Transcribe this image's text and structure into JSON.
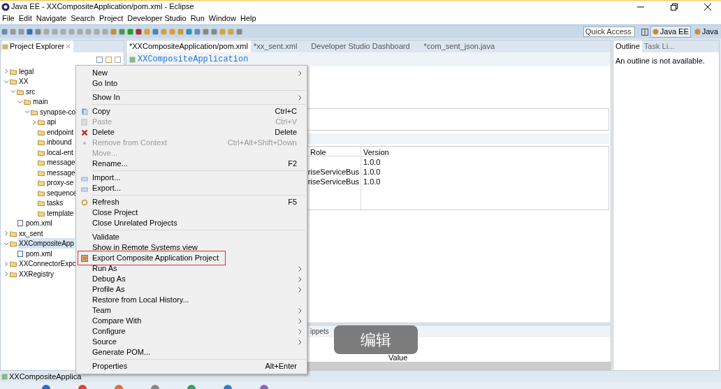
{
  "window": {
    "title": "Java EE - XXCompositeApplication/pom.xml - Eclipse"
  },
  "menubar": [
    "File",
    "Edit",
    "Navigate",
    "Search",
    "Project",
    "Developer Studio",
    "Run",
    "Window",
    "Help"
  ],
  "toolbar": {
    "quick_access": {
      "placeholder": "Quick Access"
    },
    "perspectives": [
      {
        "label": "Java EE",
        "selected": true
      },
      {
        "label": "Java",
        "selected": false
      }
    ]
  },
  "project_explorer": {
    "title": "Project Explorer",
    "tree": [
      {
        "label": "legal",
        "expanded": false,
        "selected": false
      },
      {
        "label": "XX",
        "expanded": true,
        "selected": false,
        "children": [
          {
            "label": "src",
            "expanded": true,
            "selected": false,
            "children": [
              {
                "label": "main",
                "expanded": true,
                "selected": false,
                "children": [
                  {
                    "label": "synapse-co",
                    "expanded": true,
                    "selected": false,
                    "children": [
                      {
                        "label": "api",
                        "expanded": false,
                        "selected": false
                      },
                      {
                        "label": "endpoint",
                        "selected": false
                      },
                      {
                        "label": "inbound",
                        "selected": false
                      },
                      {
                        "label": "local-ent",
                        "selected": false
                      },
                      {
                        "label": "message",
                        "selected": false
                      },
                      {
                        "label": "message",
                        "selected": false
                      },
                      {
                        "label": "proxy-se",
                        "selected": false
                      },
                      {
                        "label": "sequence",
                        "selected": false
                      },
                      {
                        "label": "tasks",
                        "selected": false
                      },
                      {
                        "label": "template",
                        "selected": false
                      }
                    ]
                  }
                ]
              }
            ]
          },
          {
            "label": "pom.xml",
            "selected": false
          }
        ]
      },
      {
        "label": "xx_sent",
        "expanded": false,
        "selected": false
      },
      {
        "label": "XXCompositeApp",
        "expanded": true,
        "selected": true,
        "children": [
          {
            "label": "pom.xml",
            "selected": false
          }
        ]
      },
      {
        "label": "XXConnectorExpo",
        "expanded": false,
        "selected": false
      },
      {
        "label": "XXRegistry",
        "expanded": false,
        "selected": false
      }
    ]
  },
  "editor": {
    "tabs": [
      {
        "label": "*XXCompositeApplication/pom.xml",
        "selected": true
      },
      {
        "label": "*xx_sent.xml",
        "selected": false
      },
      {
        "label": "Developer Studio Dashboard",
        "selected": false
      },
      {
        "label": "*com_sent_json.java",
        "selected": false
      }
    ],
    "heading": "XXCompositeApplication",
    "table": {
      "columns": [
        "Role",
        "Version"
      ],
      "rows": [
        [
          "",
          "1.0.0"
        ],
        [
          "riseServiceBus",
          "1.0.0"
        ],
        [
          "riseServiceBus",
          "1.0.0"
        ]
      ]
    }
  },
  "bottom_panel": {
    "tab": "ippets",
    "column": "Value"
  },
  "outline": {
    "tabs": [
      {
        "label": "Outline",
        "selected": true
      },
      {
        "label": "Task Li...",
        "selected": false
      }
    ],
    "message": "An outline is not available."
  },
  "context_menu": [
    {
      "kind": "item",
      "label": "New",
      "submenu": true,
      "disabled": false,
      "annotated": false
    },
    {
      "kind": "item",
      "label": "Go Into",
      "submenu": false,
      "disabled": false,
      "annotated": false
    },
    {
      "kind": "separator"
    },
    {
      "kind": "item",
      "label": "Show In",
      "submenu": true,
      "disabled": false,
      "annotated": false
    },
    {
      "kind": "separator"
    },
    {
      "kind": "item",
      "label": "Copy",
      "shortcut": "Ctrl+C",
      "submenu": false,
      "disabled": false,
      "annotated": false
    },
    {
      "kind": "item",
      "label": "Paste",
      "shortcut": "Ctrl+V",
      "submenu": false,
      "disabled": true,
      "annotated": false
    },
    {
      "kind": "item",
      "label": "Delete",
      "shortcut": "Delete",
      "submenu": false,
      "disabled": false,
      "annotated": false
    },
    {
      "kind": "item",
      "label": "Remove from Context",
      "shortcut": "Ctrl+Alt+Shift+Down",
      "submenu": false,
      "disabled": true,
      "annotated": false
    },
    {
      "kind": "item",
      "label": "Move...",
      "submenu": false,
      "disabled": true,
      "annotated": false
    },
    {
      "kind": "item",
      "label": "Rename...",
      "shortcut": "F2",
      "submenu": false,
      "disabled": false,
      "annotated": false
    },
    {
      "kind": "separator"
    },
    {
      "kind": "item",
      "label": "Import...",
      "submenu": false,
      "disabled": false,
      "annotated": false
    },
    {
      "kind": "item",
      "label": "Export...",
      "submenu": false,
      "disabled": false,
      "annotated": false
    },
    {
      "kind": "separator"
    },
    {
      "kind": "item",
      "label": "Refresh",
      "shortcut": "F5",
      "submenu": false,
      "disabled": false,
      "annotated": false
    },
    {
      "kind": "item",
      "label": "Close Project",
      "submenu": false,
      "disabled": false,
      "annotated": false
    },
    {
      "kind": "item",
      "label": "Close Unrelated Projects",
      "submenu": false,
      "disabled": false,
      "annotated": false
    },
    {
      "kind": "separator"
    },
    {
      "kind": "item",
      "label": "Validate",
      "submenu": false,
      "disabled": false,
      "annotated": false
    },
    {
      "kind": "item",
      "label": "Show in Remote Systems view",
      "submenu": false,
      "disabled": false,
      "annotated": false
    },
    {
      "kind": "item",
      "label": "Export Composite Application Project",
      "submenu": false,
      "disabled": false,
      "annotated": true
    },
    {
      "kind": "item",
      "label": "Run As",
      "submenu": true,
      "disabled": false,
      "annotated": false
    },
    {
      "kind": "item",
      "label": "Debug As",
      "submenu": true,
      "disabled": false,
      "annotated": false
    },
    {
      "kind": "item",
      "label": "Profile As",
      "submenu": true,
      "disabled": false,
      "annotated": false
    },
    {
      "kind": "item",
      "label": "Restore from Local History...",
      "submenu": false,
      "disabled": false,
      "annotated": false
    },
    {
      "kind": "item",
      "label": "Team",
      "submenu": true,
      "disabled": false,
      "annotated": false
    },
    {
      "kind": "item",
      "label": "Compare With",
      "submenu": true,
      "disabled": false,
      "annotated": false
    },
    {
      "kind": "item",
      "label": "Configure",
      "submenu": true,
      "disabled": false,
      "annotated": false
    },
    {
      "kind": "item",
      "label": "Source",
      "submenu": true,
      "disabled": false,
      "annotated": false
    },
    {
      "kind": "item",
      "label": "Generate POM...",
      "submenu": false,
      "disabled": false,
      "annotated": false
    },
    {
      "kind": "separator"
    },
    {
      "kind": "item",
      "label": "Properties",
      "shortcut": "Alt+Enter",
      "submenu": false,
      "disabled": false,
      "annotated": false
    }
  ],
  "overlay_button": "编辑",
  "status_bar": "XXCompositeApplica"
}
